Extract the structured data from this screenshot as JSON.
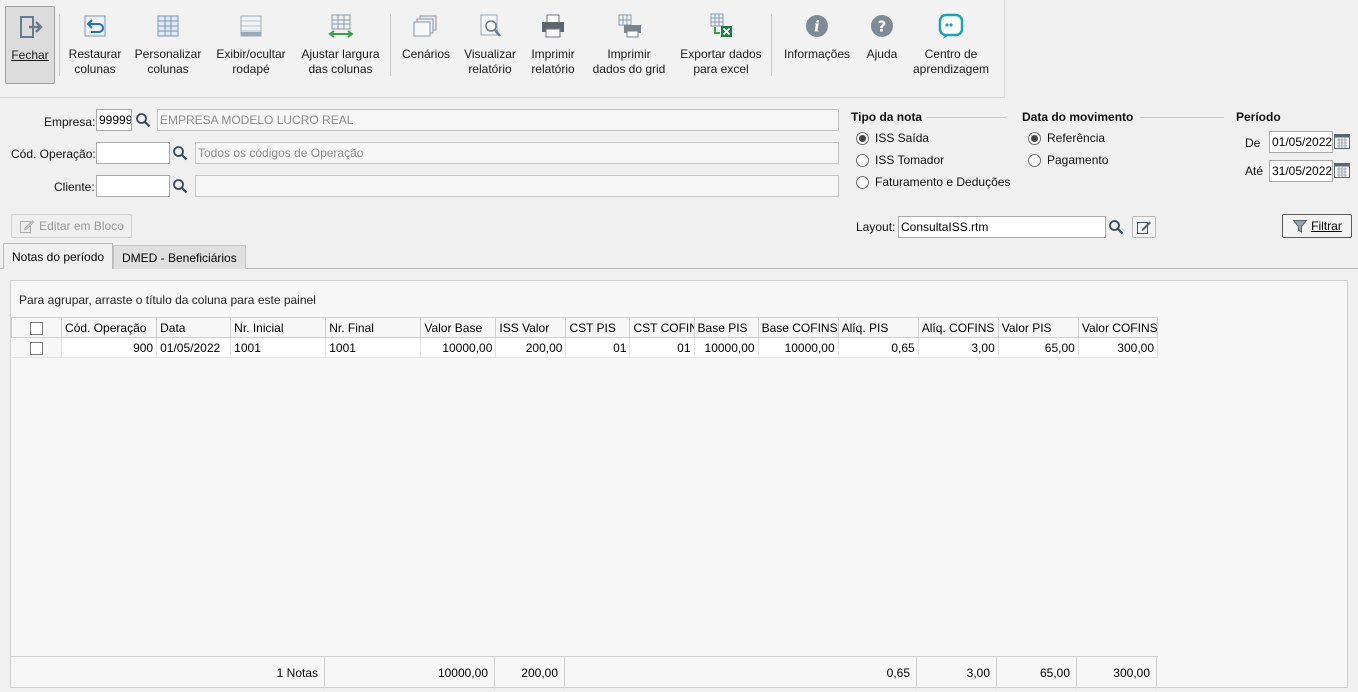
{
  "toolbar": {
    "items": [
      {
        "label1": "Fechar",
        "label2": "",
        "icon": "exit-icon"
      },
      {
        "label1": "Restaurar",
        "label2": "colunas",
        "icon": "restore-columns-icon"
      },
      {
        "label1": "Personalizar",
        "label2": "colunas",
        "icon": "customize-columns-icon"
      },
      {
        "label1": "Exibir/ocultar",
        "label2": "rodapé",
        "icon": "footer-toggle-icon"
      },
      {
        "label1": "Ajustar largura",
        "label2": "das colunas",
        "icon": "fit-columns-icon"
      },
      {
        "label1": "Cenários",
        "label2": "",
        "icon": "scenarios-icon"
      },
      {
        "label1": "Visualizar",
        "label2": "relatório",
        "icon": "preview-report-icon"
      },
      {
        "label1": "Imprimir",
        "label2": "relatório",
        "icon": "print-report-icon"
      },
      {
        "label1": "Imprimir",
        "label2": "dados do grid",
        "icon": "print-grid-icon"
      },
      {
        "label1": "Exportar dados",
        "label2": "para excel",
        "icon": "excel-export-icon"
      },
      {
        "label1": "Informações",
        "label2": "",
        "icon": "info-icon"
      },
      {
        "label1": "Ajuda",
        "label2": "",
        "icon": "help-icon"
      },
      {
        "label1": "Centro de",
        "label2": "aprendizagem",
        "icon": "learning-center-icon"
      }
    ]
  },
  "filters": {
    "empresa_label": "Empresa:",
    "empresa_code": "99999",
    "empresa_name": "EMPRESA MODELO LUCRO REAL",
    "operacao_label": "Cód. Operação:",
    "operacao_code": "",
    "operacao_placeholder": "Todos os códigos de Operação",
    "cliente_label": "Cliente:",
    "cliente_code": "",
    "cliente_name": ""
  },
  "tipo_nota": {
    "title": "Tipo da nota",
    "options": [
      "ISS Saída",
      "ISS Tomador",
      "Faturamento e Deduções"
    ],
    "selected": 0
  },
  "data_movimento": {
    "title": "Data do movimento",
    "options": [
      "Referência",
      "Pagamento"
    ],
    "selected": 0
  },
  "periodo": {
    "title": "Período",
    "de_label": "De",
    "de_value": "01/05/2022",
    "ate_label": "Até",
    "ate_value": "31/05/2022"
  },
  "actions": {
    "editar_bloco": "Editar em Bloco",
    "layout_label": "Layout:",
    "layout_value": "ConsultaISS.rtm",
    "filtrar": "Filtrar"
  },
  "tabs": [
    "Notas do período",
    "DMED - Beneficiários"
  ],
  "grid": {
    "group_hint": "Para agrupar, arraste o título da coluna para este painel",
    "columns": [
      "Cód. Operação",
      "Data",
      "Nr. Inicial",
      "Nr. Final",
      "Valor Base",
      "ISS Valor",
      "CST PIS",
      "CST COFIN",
      "Base PIS",
      "Base COFINS",
      "Alíq. PIS",
      "Alíq. COFINS",
      "Valor PIS",
      "Valor COFINS"
    ],
    "rows": [
      [
        "900",
        "01/05/2022",
        "1001",
        "1001",
        "10000,00",
        "200,00",
        "01",
        "01",
        "10000,00",
        "10000,00",
        "0,65",
        "3,00",
        "65,00",
        "300,00"
      ]
    ],
    "footer": {
      "count": "1 Notas",
      "valor_base": "10000,00",
      "iss_valor": "200,00",
      "aliq_pis": "0,65",
      "aliq_cofins": "3,00",
      "valor_pis": "65,00",
      "valor_cofins": "300,00"
    }
  }
}
